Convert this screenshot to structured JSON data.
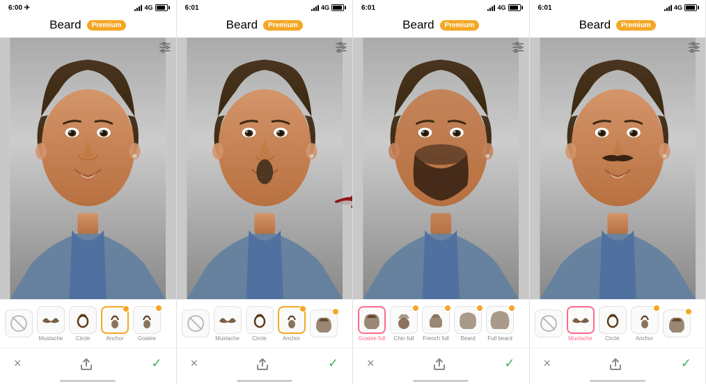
{
  "panels": [
    {
      "id": "panel-1",
      "statusBar": {
        "time": "6:00",
        "signal": "4G",
        "hasArrow": true
      },
      "header": {
        "title": "Beard",
        "premiumLabel": "Premium"
      },
      "beardOptions": [
        {
          "id": "none",
          "label": "",
          "selected": false,
          "premium": false,
          "type": "no-beard"
        },
        {
          "id": "mustache",
          "label": "Mustache",
          "selected": false,
          "premium": false,
          "type": "mustache"
        },
        {
          "id": "circle",
          "label": "Circle",
          "selected": false,
          "premium": false,
          "type": "circle"
        },
        {
          "id": "anchor",
          "label": "Anchor",
          "selected": true,
          "premium": true,
          "type": "anchor",
          "dotColor": "orange"
        },
        {
          "id": "goatee",
          "label": "Goatee",
          "selected": false,
          "premium": true,
          "type": "goatee",
          "dotColor": "orange"
        }
      ],
      "actions": {
        "cancel": "×",
        "confirm": "✓"
      },
      "showArrow": false,
      "faceStyle": "clean"
    },
    {
      "id": "panel-2",
      "statusBar": {
        "time": "6:01",
        "signal": "4G",
        "hasArrow": false
      },
      "header": {
        "title": "Beard",
        "premiumLabel": "Premium"
      },
      "beardOptions": [
        {
          "id": "none",
          "label": "",
          "selected": false,
          "premium": false,
          "type": "no-beard"
        },
        {
          "id": "mustache",
          "label": "Mustache",
          "selected": false,
          "premium": false,
          "type": "mustache"
        },
        {
          "id": "circle",
          "label": "Circle",
          "selected": false,
          "premium": false,
          "type": "circle"
        },
        {
          "id": "anchor",
          "label": "Anchor",
          "selected": true,
          "premium": true,
          "type": "anchor",
          "dotColor": "orange"
        },
        {
          "id": "column",
          "label": "",
          "selected": false,
          "premium": true,
          "type": "full",
          "dotColor": "orange"
        }
      ],
      "actions": {
        "cancel": "×",
        "confirm": "✓"
      },
      "showArrow": true,
      "faceStyle": "goatee"
    },
    {
      "id": "panel-3",
      "statusBar": {
        "time": "6:01",
        "signal": "4G",
        "hasArrow": false
      },
      "header": {
        "title": "Beard",
        "premiumLabel": "Premium"
      },
      "beardOptions": [
        {
          "id": "goatee-full",
          "label": "Goatee full",
          "selected": true,
          "premium": false,
          "type": "goatee-full",
          "dotColor": "pink"
        },
        {
          "id": "chin-full",
          "label": "Chin full",
          "selected": false,
          "premium": true,
          "type": "chin-full",
          "dotColor": "orange"
        },
        {
          "id": "french-full",
          "label": "French full",
          "selected": false,
          "premium": true,
          "type": "french-full",
          "dotColor": "orange"
        },
        {
          "id": "beard",
          "label": "Beard",
          "selected": false,
          "premium": true,
          "type": "beard",
          "dotColor": "orange"
        },
        {
          "id": "full-beard",
          "label": "Full beard",
          "selected": false,
          "premium": true,
          "type": "full-beard",
          "dotColor": "orange"
        }
      ],
      "actions": {
        "cancel": "×",
        "confirm": "✓"
      },
      "showArrow": false,
      "faceStyle": "full-beard"
    },
    {
      "id": "panel-4",
      "statusBar": {
        "time": "6:01",
        "signal": "4G",
        "hasArrow": false
      },
      "header": {
        "title": "Beard",
        "premiumLabel": "Premium"
      },
      "beardOptions": [
        {
          "id": "none",
          "label": "",
          "selected": false,
          "premium": false,
          "type": "no-beard"
        },
        {
          "id": "mustache",
          "label": "Mustache",
          "selected": true,
          "premium": false,
          "type": "mustache",
          "dotColor": "pink"
        },
        {
          "id": "circle",
          "label": "Circle",
          "selected": false,
          "premium": false,
          "type": "circle"
        },
        {
          "id": "anchor",
          "label": "Anchor",
          "selected": false,
          "premium": true,
          "type": "anchor",
          "dotColor": "orange"
        },
        {
          "id": "column2",
          "label": "",
          "selected": false,
          "premium": true,
          "type": "full",
          "dotColor": "orange"
        }
      ],
      "actions": {
        "cancel": "×",
        "confirm": "✓"
      },
      "showArrow": false,
      "faceStyle": "mustache"
    }
  ]
}
